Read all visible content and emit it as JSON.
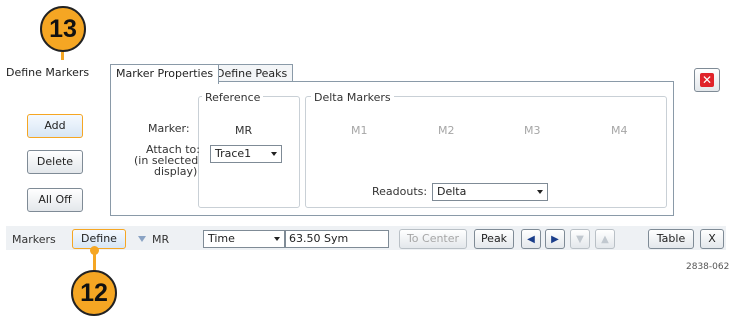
{
  "callouts": {
    "top": "13",
    "bottom": "12"
  },
  "panel": {
    "title": "Define Markers",
    "tabs": [
      "Marker Properties",
      "Define Peaks"
    ],
    "buttons": {
      "add": "Add",
      "delete": "Delete",
      "all_off": "All Off"
    },
    "reference": {
      "title": "Reference",
      "marker_label": "Marker:",
      "marker_value": "MR",
      "attach_label_1": "Attach to:",
      "attach_label_2": "(in selected",
      "attach_label_3": "display)",
      "attach_value": "Trace1"
    },
    "delta": {
      "title": "Delta Markers",
      "markers": [
        "M1",
        "M2",
        "M3",
        "M4"
      ],
      "readouts_label": "Readouts:",
      "readouts_value": "Delta"
    }
  },
  "toolbar": {
    "markers_label": "Markers",
    "define_label": "Define",
    "marker_selected": "MR",
    "axis_value": "Time",
    "position_value": "63.50 Sym",
    "to_center_label": "To Center",
    "peak_label": "Peak",
    "table_label": "Table",
    "x_label": "X"
  },
  "figure_id": "2838-062",
  "icons": {
    "close": "close-icon",
    "left": "arrow-left-icon",
    "right": "arrow-right-icon",
    "up": "arrow-up-icon",
    "down": "arrow-down-icon"
  }
}
